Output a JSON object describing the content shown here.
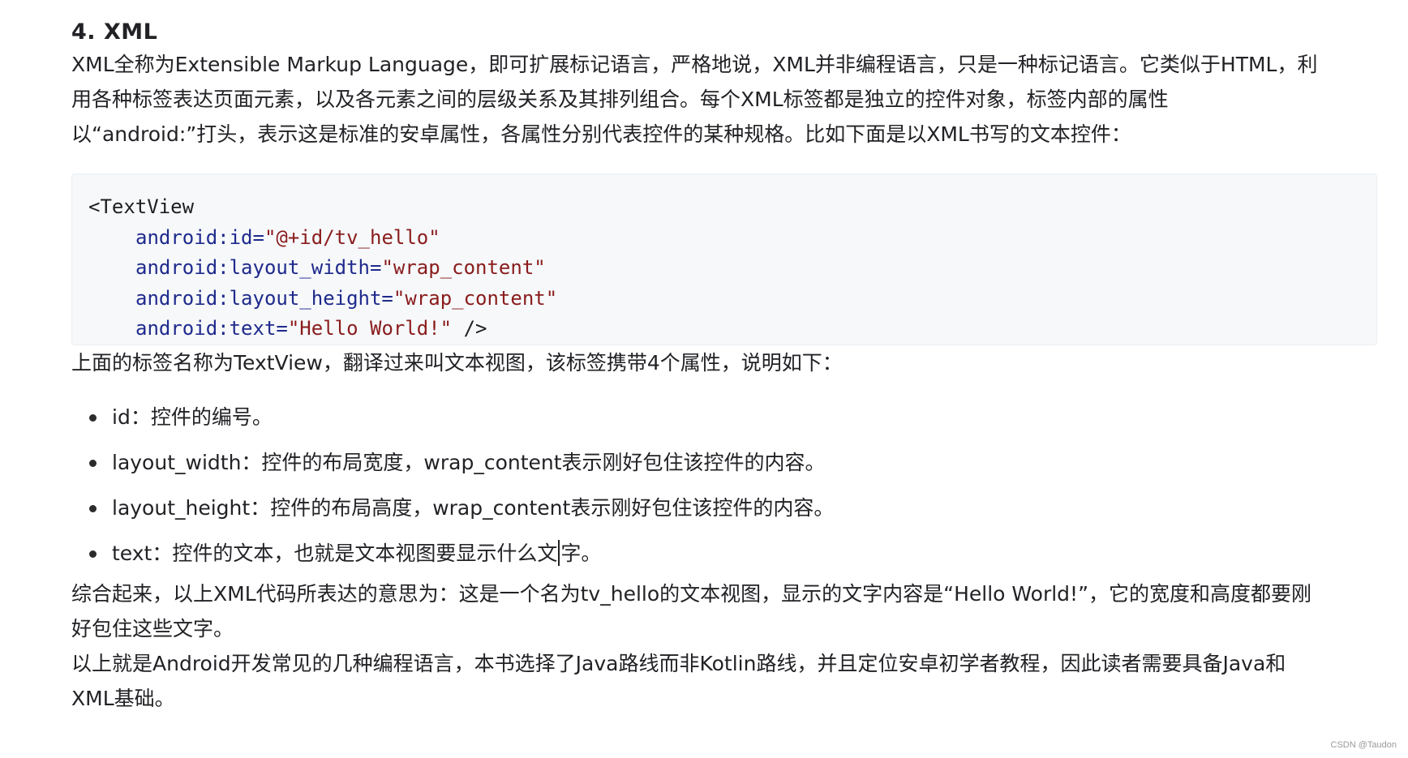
{
  "section": {
    "heading": "4. XML",
    "intro_line1": "XML全称为Extensible Markup Language，即可扩展标记语言，严格地说，XML并非编程语言，只是一种标记语言。它类似于HTML，利",
    "intro_line2": "用各种标签表达页面元素，以及各元素之间的层级关系及其排列组合。每个XML标签都是独立的控件对象，标签内部的属性",
    "intro_line3": "以“android:”打头，表示这是标准的安卓属性，各属性分别代表控件的某种规格。比如下面是以XML书写的文本控件："
  },
  "code": {
    "open_tag": "<TextView",
    "lines": [
      {
        "attr": "android:id=",
        "value": "\"@+id/tv_hello\"",
        "tail": ""
      },
      {
        "attr": "android:layout_width=",
        "value": "\"wrap_content\"",
        "tail": ""
      },
      {
        "attr": "android:layout_height=",
        "value": "\"wrap_content\"",
        "tail": ""
      },
      {
        "attr": "android:text=",
        "value": "\"Hello World!\"",
        "tail": " />"
      }
    ]
  },
  "after_code": "上面的标签名称为TextView，翻译过来叫文本视图，该标签携带4个属性，说明如下：",
  "attributes": [
    {
      "text": "id：控件的编号。"
    },
    {
      "text": "layout_width：控件的布局宽度，wrap_content表示刚好包住该控件的内容。"
    },
    {
      "text": "layout_height：控件的布局高度，wrap_content表示刚好包住该控件的内容。"
    },
    {
      "text_before_cursor": "text：控件的文本，也就是文本视图要显示什么文",
      "text_after_cursor": "字。"
    }
  ],
  "summary_line1": "综合起来，以上XML代码所表达的意思为：这是一个名为tv_hello的文本视图，显示的文字内容是“Hello World!”，它的宽度和高度都要刚",
  "summary_line2": "好包住这些文字。",
  "final_line1": "以上就是Android开发常见的几种编程语言，本书选择了Java路线而非Kotlin路线，并且定位安卓初学者教程，因此读者需要具备Java和",
  "final_line2": "XML基础。",
  "watermark": "CSDN @Taudon"
}
